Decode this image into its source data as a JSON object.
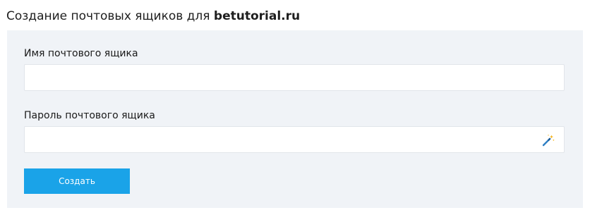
{
  "header": {
    "title_prefix": "Создание почтовых ящиков для ",
    "domain": "betutorial.ru"
  },
  "form": {
    "mailbox_name": {
      "label": "Имя почтового ящика",
      "value": "",
      "placeholder": ""
    },
    "mailbox_password": {
      "label": "Пароль почтового ящика",
      "value": "",
      "placeholder": "",
      "generator_icon": "magic-wand-icon"
    },
    "submit_label": "Создать"
  },
  "colors": {
    "panel_background": "#f0f3f7",
    "button_background": "#1aa3e8",
    "button_text": "#ffffff",
    "field_border": "#e1e5ea"
  }
}
